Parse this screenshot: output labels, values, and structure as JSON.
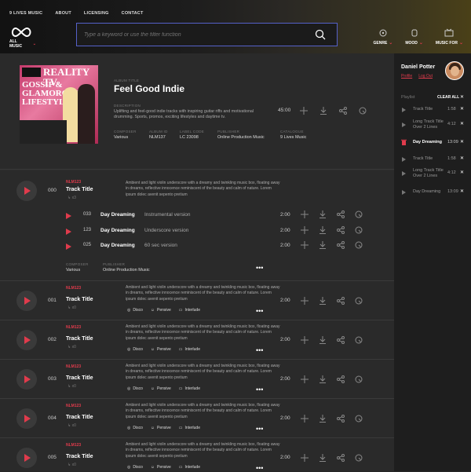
{
  "nav": {
    "links": [
      "9 LIVES MUSIC",
      "ABOUT",
      "LICENSING",
      "CONTACT"
    ]
  },
  "logo": {
    "label": "ALL MUSIC"
  },
  "search": {
    "placeholder": "Type a keyword or use the filter function"
  },
  "filters": [
    "GENRE",
    "MOOD",
    "MUSIC FOR"
  ],
  "album": {
    "cover_title": "REALITY TV",
    "cover_sub": "GOSSIP & GLAMOROUS LIFESTYLE",
    "title_label": "ALBUM TITLE",
    "title": "Feel Good Indie",
    "desc_label": "DESCRIPTION",
    "description": "Uplifting and feel-good indie tracks with inspiring guitar riffs and motivational drumming. Sports, promos, exciting lifestyles and daytime tv.",
    "duration": "45:00",
    "composer_label": "COMPOSER",
    "composer": "Various",
    "album_id_label": "ALBUM ID",
    "album_id": "NLM137",
    "label_code_label": "LABEL CODE",
    "label_code": "LC 23098",
    "publisher_label": "PUBLISHER",
    "publisher": "Online Production Music",
    "catalogue_label": "CATALOGUE",
    "catalogue": "9 Lives Music"
  },
  "columns": {
    "track": "TRACK & VERSIONS",
    "description": "DESCRIPTION",
    "add": "ADD",
    "save": "SAVE",
    "share": "SHARE",
    "cue": "CUE"
  },
  "tracks": [
    {
      "num": "000",
      "code": "NLM123",
      "name": "Track Title",
      "versions": "x3",
      "desc": "Ambient and light violin underscore with a dreamy and twinkling music box, floating away in dreams, reflective innocence reminiscent of the beauty and calm of nature. Lorem ipsum dolec avenit sepento pretium",
      "dur": "2:00",
      "subs": [
        {
          "num": "033",
          "name": "Day Dreaming",
          "desc": "Instrumental version",
          "dur": "2:00"
        },
        {
          "num": "123",
          "name": "Day Dreaming",
          "desc": "Underscore version",
          "dur": "2:00"
        },
        {
          "num": "025",
          "name": "Day Dreaming",
          "desc": "60 sec version",
          "dur": "2:00"
        }
      ],
      "composer_label": "COMPOSER",
      "composer": "Various",
      "publisher_label": "PUBLISHER",
      "publisher": "Online Production Music"
    },
    {
      "num": "001",
      "code": "NLM123",
      "name": "Track Title",
      "versions": "x0",
      "desc": "Ambient and light violin underscore with a dreamy and twinkling music box, floating away in dreams, reflective innocence reminiscent of the beauty and calm of nature. Lorem ipsum dolec avenit sepento pretium",
      "dur": "2:00",
      "tags": [
        "Disco",
        "Pensive",
        "Interlude"
      ]
    },
    {
      "num": "002",
      "code": "NLM123",
      "name": "Track Title",
      "versions": "x0",
      "desc": "Ambient and light violin underscore with a dreamy and twinkling music box, floating away in dreams, reflective innocence reminiscent of the beauty and calm of nature. Lorem ipsum dolec avenit sepento pretium",
      "dur": "2:00",
      "tags": [
        "Disco",
        "Pensive",
        "Interlude"
      ]
    },
    {
      "num": "003",
      "code": "NLM123",
      "name": "Track Title",
      "versions": "x0",
      "desc": "Ambient and light violin underscore with a dreamy and twinkling music box, floating away in dreams, reflective innocence reminiscent of the beauty and calm of nature. Lorem ipsum dolec avenit sepento pretium",
      "dur": "2:00",
      "tags": [
        "Disco",
        "Pensive",
        "Interlude"
      ]
    },
    {
      "num": "004",
      "code": "NLM123",
      "name": "Track Title",
      "versions": "x0",
      "desc": "Ambient and light violin underscore with a dreamy and twinkling music box, floating away in dreams, reflective innocence reminiscent of the beauty and calm of nature. Lorem ipsum dolec avenit sepento pretium",
      "dur": "2:00",
      "tags": [
        "Disco",
        "Pensive",
        "Interlude"
      ]
    },
    {
      "num": "005",
      "code": "NLM123",
      "name": "Track Title",
      "versions": "x0",
      "desc": "Ambient and light violin underscore with a dreamy and twinkling music box, floating away in dreams, reflective innocence reminiscent of the beauty and calm of nature. Lorem ipsum dolec avenit sepento pretium",
      "dur": "2:00",
      "tags": [
        "Disco",
        "Pensive",
        "Interlude"
      ]
    }
  ],
  "user": {
    "name": "Daniel Potter",
    "profile": "Profile",
    "logout": "Log Out"
  },
  "playlist": {
    "label": "Playlist",
    "clear_all": "CLEAR ALL",
    "items": [
      {
        "name": "Track Title",
        "dur": "1:58",
        "active": false
      },
      {
        "name": "Long Track Title Over 2 Lines",
        "dur": "4:12",
        "active": false
      },
      {
        "name": "Day Dreaming",
        "dur": "13:09",
        "active": true
      },
      {
        "name": "Track Title",
        "dur": "1:58",
        "active": false
      },
      {
        "name": "Long Track Title Over 2 Lines",
        "dur": "4:12",
        "active": false
      },
      {
        "name": "Day Dreaming",
        "dur": "13:09",
        "active": false
      }
    ]
  },
  "colors": {
    "accent": "#e03b4c",
    "bg": "#2c2c2c",
    "sidebar": "#1e1e1e",
    "search_border": "#5561c9"
  },
  "icons": [
    "search-icon",
    "genre-icon",
    "mood-icon",
    "music-for-icon",
    "add-icon",
    "download-icon",
    "share-icon",
    "cue-icon",
    "clock-icon",
    "disco-icon",
    "pensive-icon",
    "interlude-icon",
    "more-icon"
  ]
}
